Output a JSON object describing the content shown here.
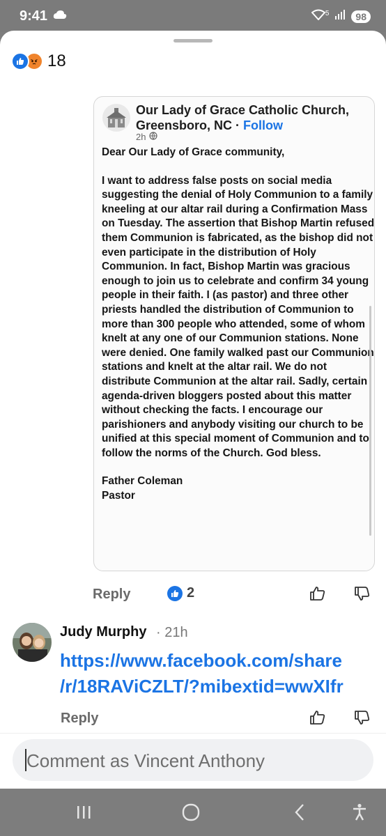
{
  "status_bar": {
    "time": "9:41",
    "battery": "98",
    "signal_label": "5",
    "icons": [
      "cloud-icon",
      "wifi-icon",
      "signal-icon",
      "battery-icon"
    ]
  },
  "reactions": {
    "count": "18",
    "types": [
      "like",
      "angry"
    ]
  },
  "shared_post": {
    "page_name": "Our Lady of Grace Catholic Church, Greensboro, NC",
    "separator": " · ",
    "follow_label": "Follow",
    "time": "2h",
    "privacy_icon": "globe-icon",
    "greeting": "Dear Our Lady of Grace community,",
    "body": "I want to address false posts on social media suggesting the denial of Holy Communion to a family kneeling at our altar rail during a Confirmation Mass on Tuesday. The assertion that Bishop Martin refused them Communion is fabricated, as the bishop did not even participate in the distribution of Holy Communion. In fact, Bishop Martin was gracious enough to join us to celebrate and confirm 34 young people in their faith. I (as pastor) and three other priests handled the distribution of Communion to more than 300 people who attended, some of whom knelt at any one of our Communion stations. None were denied. One family walked past our Communion stations and knelt at the altar rail. We do not distribute Communion at the altar rail. Sadly, certain agenda-driven bloggers posted about this matter without checking the facts. I encourage our parishioners and anybody visiting our church to be unified at this special moment of Communion and to follow the norms of the Church. God bless.",
    "signature_name": "Father Coleman",
    "signature_title": "Pastor"
  },
  "comment_one_actions": {
    "reply_label": "Reply",
    "like_count": "2"
  },
  "comment_two": {
    "author": "Judy Murphy",
    "time": "· 21h",
    "link_line1": "https://www.facebook.com/share",
    "link_line2": "/r/18RAViCZLT/?mibextid=wwXIfr",
    "reply_label": "Reply"
  },
  "composer": {
    "placeholder": "Comment as Vincent Anthony"
  },
  "colors": {
    "accent": "#1b74e4",
    "angry": "#f0842c",
    "system_bar": "#7b7b7b"
  }
}
